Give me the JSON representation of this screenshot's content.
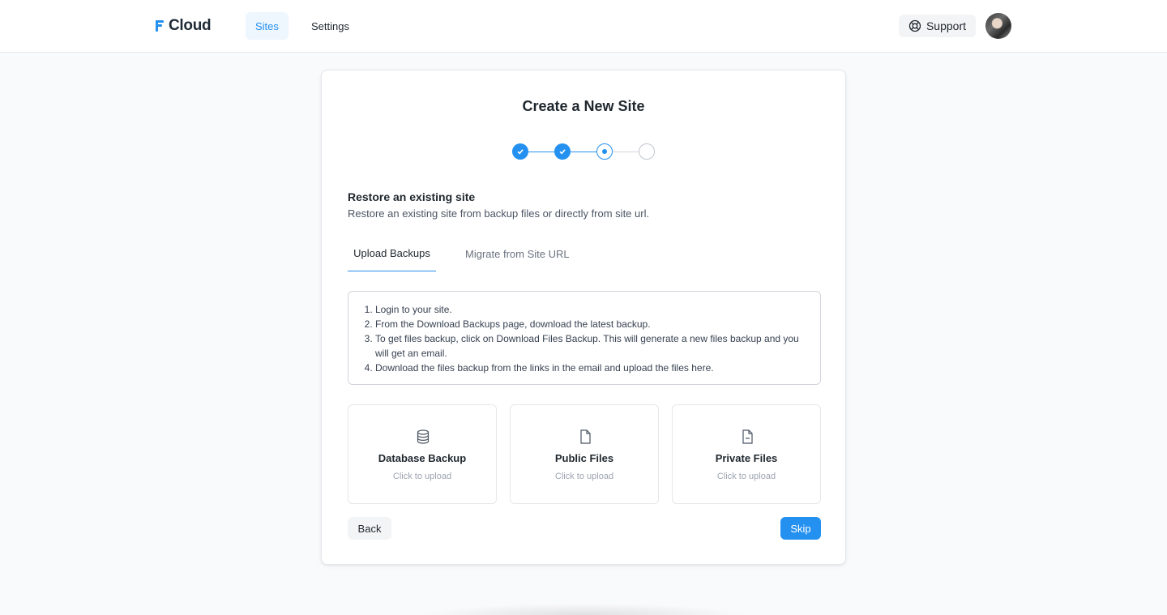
{
  "header": {
    "brand": "Cloud",
    "nav": {
      "sites": "Sites",
      "settings": "Settings"
    },
    "support_label": "Support"
  },
  "card": {
    "title": "Create a New Site",
    "steps": [
      "done",
      "done",
      "current",
      "todo"
    ],
    "section_title": "Restore an existing site",
    "section_subtitle": "Restore an existing site from backup files or directly from site url.",
    "tabs": {
      "upload": "Upload Backups",
      "migrate": "Migrate from Site URL"
    },
    "instructions": [
      "Login to your site.",
      "From the Download Backups page, download the latest backup.",
      "To get files backup, click on Download Files Backup. This will generate a new files backup and you will get an email.",
      "Download the files backup from the links in the email and upload the files here."
    ],
    "uploads": [
      {
        "label": "Database Backup",
        "hint": "Click to upload",
        "icon": "database-icon"
      },
      {
        "label": "Public Files",
        "hint": "Click to upload",
        "icon": "file-icon"
      },
      {
        "label": "Private Files",
        "hint": "Click to upload",
        "icon": "file-minus-icon"
      }
    ],
    "back_label": "Back",
    "skip_label": "Skip"
  },
  "colors": {
    "accent": "#2490ef",
    "text": "#1f272e",
    "border": "#e5e7eb"
  }
}
